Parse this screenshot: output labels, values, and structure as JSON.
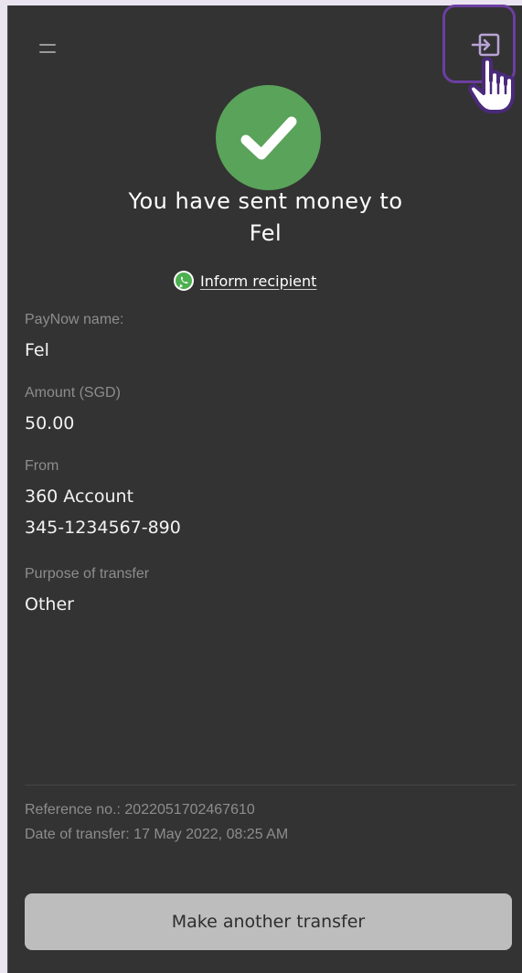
{
  "header": {
    "menu_icon": "hamburger-menu-icon",
    "exit_icon": "exit-icon"
  },
  "status": {
    "icon": "check-icon",
    "color": "#5aa35a",
    "headline_line1": "You have sent money to",
    "headline_line2": "Fel",
    "inform_label": "Inform recipient",
    "inform_icon": "whatsapp-icon"
  },
  "details": [
    {
      "label": "PayNow name:",
      "value": "Fel"
    },
    {
      "label": "Amount (SGD)",
      "value": "50.00"
    },
    {
      "label": "From",
      "value": "360 Account",
      "value2": "345-1234567-890"
    },
    {
      "label": "Purpose of transfer",
      "value": "Other"
    }
  ],
  "footer": {
    "reference": "Reference no.: 2022051702467610",
    "date": "Date of transfer: 17 May 2022, 08:25 AM"
  },
  "cta": {
    "label": "Make another transfer"
  },
  "colors": {
    "background": "#333333",
    "highlight": "#6b3fa0",
    "button": "#bdbdbd"
  }
}
